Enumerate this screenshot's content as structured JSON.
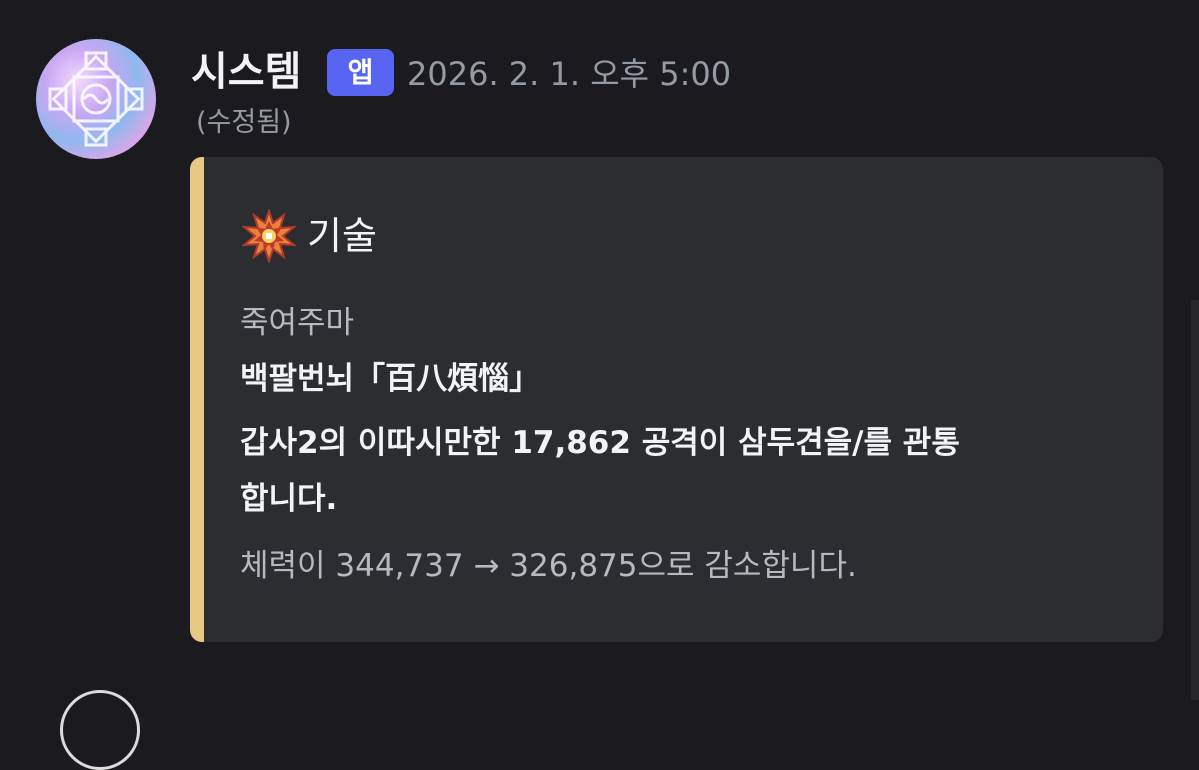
{
  "message": {
    "author": "시스템",
    "badge": "앱",
    "timestamp": "2026. 2. 1. 오후 5:00",
    "edited": "(수정됨)"
  },
  "embed": {
    "accent_color": "#e6c882",
    "icon": "spiky-star-icon",
    "title": "기술",
    "lines": [
      "죽여주마",
      "백팔번뇌「百八煩惱」",
      "갑사2의 이따시만한 17,862 공격이 삼두견을/를 관통",
      "합니다.",
      "체력이 344,737 → 326,875으로 감소합니다."
    ]
  },
  "colors": {
    "background": "#1b1b1f",
    "badge": "#5865f2",
    "embed_background": "#2b2d31"
  }
}
